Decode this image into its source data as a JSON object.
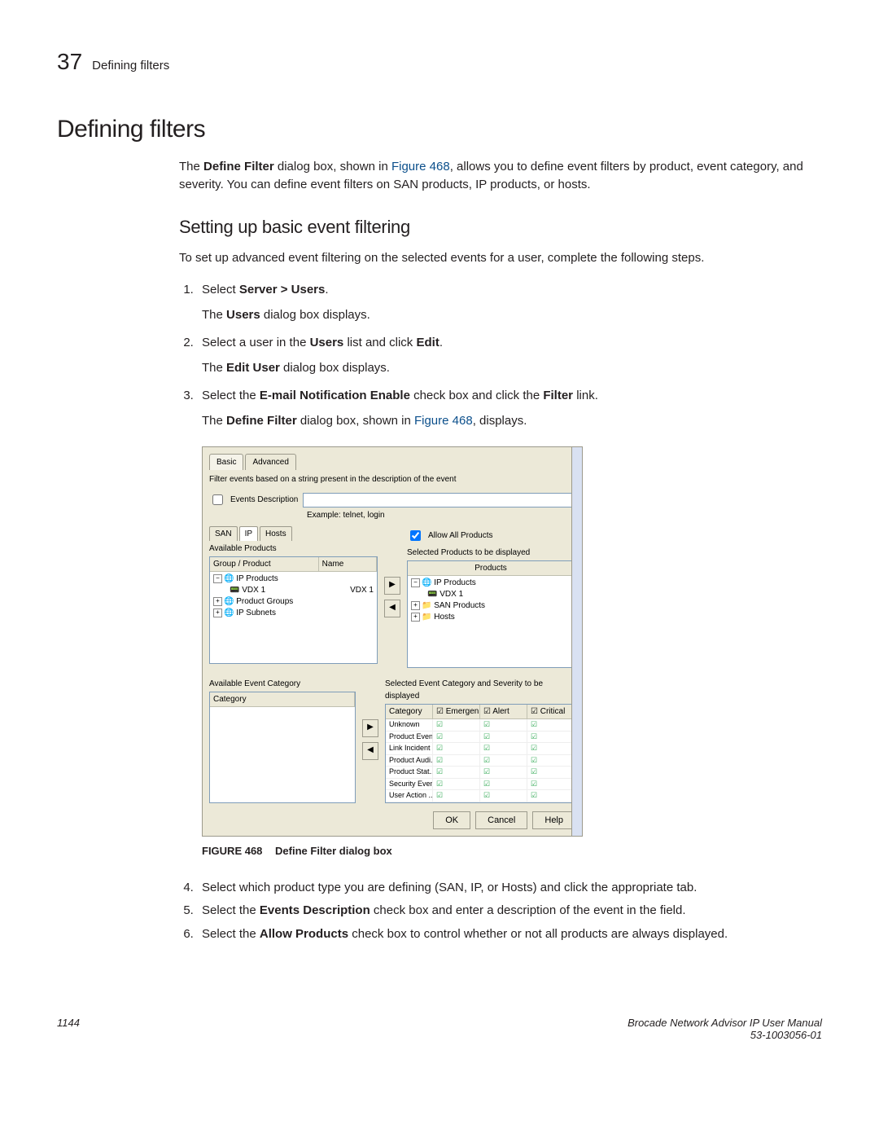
{
  "header": {
    "chapter_number": "37",
    "chapter_label": "Defining filters"
  },
  "title": "Defining filters",
  "intro_parts": {
    "p1": "The ",
    "b1": "Define Filter",
    "p2": " dialog box, shown in ",
    "link1": "Figure 468",
    "p3": ", allows you to define event filters by product, event category, and severity. You can define event filters on SAN products, IP products, or hosts."
  },
  "section_title": "Setting up basic event filtering",
  "section_intro": "To set up advanced event filtering on the selected events for a user, complete the following steps.",
  "steps": {
    "s1a": "Select ",
    "s1b": "Server > Users",
    "s1c": ".",
    "s1_sub_a": "The ",
    "s1_sub_b": "Users",
    "s1_sub_c": " dialog box displays.",
    "s2a": "Select a user in the ",
    "s2b": "Users",
    "s2c": " list and click ",
    "s2d": "Edit",
    "s2e": ".",
    "s2_sub_a": "The ",
    "s2_sub_b": "Edit User",
    "s2_sub_c": " dialog box displays.",
    "s3a": "Select the ",
    "s3b": "E-mail Notification Enable",
    "s3c": " check box and click the ",
    "s3d": "Filter",
    "s3e": " link.",
    "s3_sub_a": "The ",
    "s3_sub_b": "Define Filter",
    "s3_sub_c": " dialog box, shown in ",
    "s3_sub_link": "Figure 468",
    "s3_sub_d": ", displays.",
    "s4a": "Select which product type you are defining (SAN, IP, or Hosts) and click the appropriate tab.",
    "s5a": "Select the ",
    "s5b": "Events Description",
    "s5c": " check box and enter a description of the event in the field.",
    "s6a": "Select the ",
    "s6b": "Allow Products",
    "s6c": " check box to control whether or not all products are always displayed."
  },
  "dialog": {
    "tabs": {
      "basic": "Basic",
      "advanced": "Advanced"
    },
    "note": "Filter events based on a string present in the description of the event",
    "events_desc_label": "Events Description",
    "example_label": "Example: telnet, login",
    "subtabs": {
      "san": "SAN",
      "ip": "IP",
      "hosts": "Hosts"
    },
    "available_products": "Available Products",
    "allow_all": "Allow All Products",
    "selected_products": "Selected Products to be displayed",
    "col_group": "Group / Product",
    "col_name": "Name",
    "col_products": "Products",
    "left_tree": {
      "l1": "IP Products",
      "l1a": "VDX 1",
      "l1a_name": "VDX 1",
      "l2": "Product Groups",
      "l3": "IP Subnets"
    },
    "right_tree": {
      "r1": "IP Products",
      "r1a": "VDX 1",
      "r2": "SAN Products",
      "r3": "Hosts"
    },
    "avail_cat": "Available Event Category",
    "sel_cat": "Selected Event Category and Severity to be displayed",
    "cat_hdr": "Category",
    "sev_cols": {
      "cat": "Category",
      "emerg": "Emergen...",
      "alert": "Alert",
      "crit": "Critical"
    },
    "sev_rows": [
      "Unknown",
      "Product Event",
      "Link Incident ...",
      "Product Audi...",
      "Product Stat...",
      "Security Event",
      "User Action ..."
    ],
    "buttons": {
      "ok": "OK",
      "cancel": "Cancel",
      "help": "Help"
    }
  },
  "figure": {
    "label": "FIGURE 468",
    "caption": "Define Filter dialog box"
  },
  "footer": {
    "page": "1144",
    "manual": "Brocade Network Advisor IP User Manual",
    "docnum": "53-1003056-01"
  }
}
